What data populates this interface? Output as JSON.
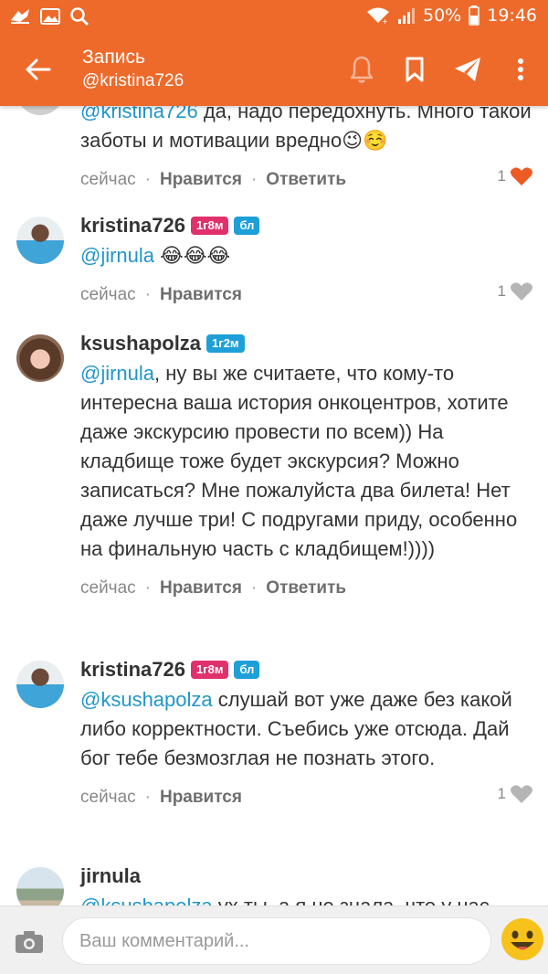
{
  "status_bar": {
    "battery": "50%",
    "time": "19:46",
    "icons": [
      "hangouts-icon",
      "gallery-icon",
      "search-icon",
      "wifi-icon",
      "signal-icon",
      "battery-icon"
    ]
  },
  "app_bar": {
    "title": "Запись",
    "subtitle": "@kristina726",
    "actions": [
      "bell-icon",
      "bookmark-icon",
      "share-icon",
      "more-icon"
    ]
  },
  "comments": [
    {
      "author": "",
      "mention": "@kristina726",
      "text": " да, надо передохнуть. Много такой заботы и мотивации вредно😉☺️",
      "time": "сейчас",
      "like_label": "Нравится",
      "reply_label": "Ответить",
      "likes": "1",
      "liked": true
    },
    {
      "author": "kristina726",
      "badges": [
        "1г8м",
        "бл"
      ],
      "mention": "@jirnula",
      "text": " 😂😂😂",
      "time": "сейчас",
      "like_label": "Нравится",
      "likes": "1",
      "liked": false
    },
    {
      "author": "ksushapolza",
      "badges": [
        "1г2м"
      ],
      "mention": "@jirnula",
      "text": ", ну вы же считаете, что кому-то интересна ваша история онкоцентров, хотите даже экскурсию провести по всем)) На кладбище тоже будет экскурсия? Можно записаться? Мне пожалуйста два билета! Нет даже лучше три! С подругами приду, особенно на финальную часть с кладбищем!))))",
      "time": "сейчас",
      "like_label": "Нравится",
      "reply_label": "Ответить"
    },
    {
      "author": "kristina726",
      "badges": [
        "1г8м",
        "бл"
      ],
      "mention": "@ksushapolza",
      "text": " слушай вот уже даже без какой либо корректности. Съебись уже отсюда. Дай бог тебе безмозглая не познать этого.",
      "time": "сейчас",
      "like_label": "Нравится",
      "likes": "1",
      "liked": false
    },
    {
      "author": "jirnula",
      "mention": "@ksushapolza",
      "text": " ух ты, а я не знала, что у нас"
    }
  ],
  "separator": "·",
  "composer": {
    "placeholder": "Ваш комментарий...",
    "camera_icon": "camera-icon",
    "emoji_icon": "emoji-icon"
  },
  "colors": {
    "accent": "#ee6a2b",
    "mention": "#2196c9",
    "heart_liked": "#ee5a24",
    "heart": "#b5b5b5",
    "badge_pink": "#e0316c",
    "badge_blue": "#1f9fd8"
  }
}
